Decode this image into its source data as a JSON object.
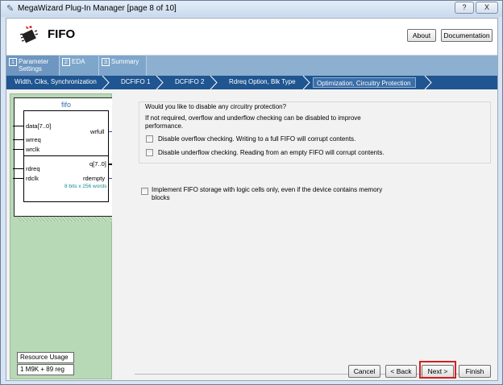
{
  "window": {
    "title": "MegaWizard Plug-In Manager [page 8 of 10]",
    "help": "?",
    "close": "X"
  },
  "header": {
    "title": "FIFO",
    "about": "About",
    "documentation": "Documentation"
  },
  "tabs": [
    {
      "num": "1",
      "label": "Parameter Settings"
    },
    {
      "num": "2",
      "label": "EDA"
    },
    {
      "num": "3",
      "label": "Summary"
    }
  ],
  "steps": [
    "Width, Clks, Synchronization",
    "DCFIFO 1",
    "DCFIFO 2",
    "Rdreq Option, Blk Type",
    "Optimization, Circuitry Protection"
  ],
  "symbol": {
    "title": "fifo",
    "pins_left": [
      "data[7..0]",
      "wrreq",
      "wrclk",
      "rdreq",
      "rdclk"
    ],
    "pins_right": [
      "wrfull",
      "q[7..0]",
      "rdempty"
    ],
    "info": "8 bits x 256 words"
  },
  "resource": {
    "label": "Resource Usage",
    "value": "1 M9K + 89 reg"
  },
  "main": {
    "question": "Would you like to disable any circuitry protection?",
    "description": "If not required, overflow and underflow checking can be disabled to improve performance.",
    "opt_overflow": "Disable overflow checking. Writing to a full FIFO will corrupt contents.",
    "opt_underflow": "Disable underflow checking. Reading from an empty FIFO will corrupt contents.",
    "opt_logic": "Implement FIFO storage with logic cells only, even if the device contains memory blocks"
  },
  "footer": {
    "cancel": "Cancel",
    "back": "< Back",
    "next": "Next >",
    "finish": "Finish"
  }
}
